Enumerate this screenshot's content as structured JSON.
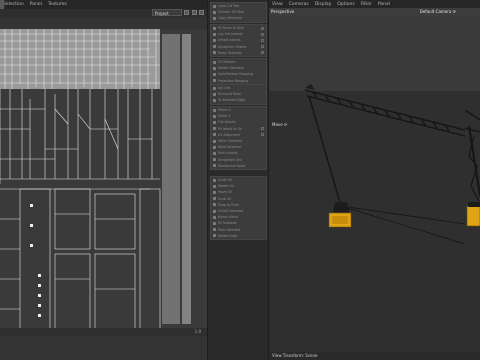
{
  "uv_editor": {
    "menu": [
      "Selection",
      "Panel",
      "Textures"
    ],
    "dropdown_value": "Project",
    "footer_number": "1.0"
  },
  "tool_panel": {
    "groups": [
      {
        "rows": [
          "Loop Cut Tool",
          "Transfer UV Map",
          "Copy Selection"
        ]
      },
      {
        "rows": [
          "Fit Faces to Grid",
          "Lay Out Islands",
          "Unfold Islands",
          "Straighten Seams",
          "Relax Selection"
        ]
      },
      {
        "rows": [
          "UV Restore",
          "Rotate Selection",
          "Auto Reduce Mapping",
          "Projection Mapping"
        ]
      },
      {
        "rows": [
          "Set UVs",
          "To Island Texel",
          "To Selected Edge"
        ]
      },
      {
        "rows": [
          "Mirror U",
          "Mirror V",
          "Flip Islands",
          "Fit Island to UV",
          "UV Alignment",
          "Stitch Selected",
          "Weld Selected",
          "Pack Islands",
          "Straighten UVs",
          "Randomize Scale"
        ]
      },
      {
        "rows": [
          "Scale UV",
          "Rotate UV",
          "Move UV",
          "Grab UV",
          "Snap to Pixel",
          "Unfold Selected",
          "Mirror Island",
          "Fit Selected",
          "Pack Selected",
          "Rotate Edge"
        ]
      }
    ]
  },
  "viewport": {
    "menu": [
      "View",
      "Cameras",
      "Display",
      "Options",
      "Filter",
      "Panel"
    ],
    "camera_label": "Perspective",
    "default_camera": "Default Camera",
    "tool_label": "Move",
    "status_text": "View Transform: Scene"
  }
}
